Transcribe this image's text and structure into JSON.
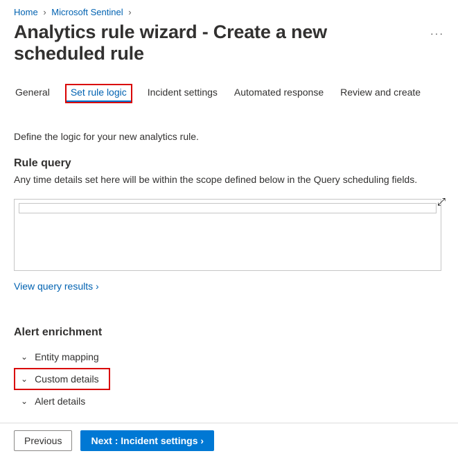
{
  "breadcrumb": {
    "home": "Home",
    "sentinel": "Microsoft Sentinel",
    "sep": "›"
  },
  "title": "Analytics rule wizard - Create a new scheduled rule",
  "more": "···",
  "tabs": {
    "general": "General",
    "set_rule_logic": "Set rule logic",
    "incident_settings": "Incident settings",
    "automated_response": "Automated response",
    "review_create": "Review and create"
  },
  "intro": "Define the logic for your new analytics rule.",
  "rule_query": {
    "title": "Rule query",
    "subtitle": "Any time details set here will be within the scope defined below in the Query scheduling fields.",
    "value": "",
    "view_results": "View query results ›"
  },
  "enrichment": {
    "title": "Alert enrichment",
    "items": [
      {
        "label": "Entity mapping",
        "expanded": false,
        "highlight": false
      },
      {
        "label": "Custom details",
        "expanded": false,
        "highlight": true
      },
      {
        "label": "Alert details",
        "expanded": false,
        "highlight": false
      }
    ]
  },
  "footer": {
    "previous": "Previous",
    "next": "Next : Incident settings ›"
  },
  "icons": {
    "chevron_down": "⌄",
    "expand": "⤢"
  }
}
